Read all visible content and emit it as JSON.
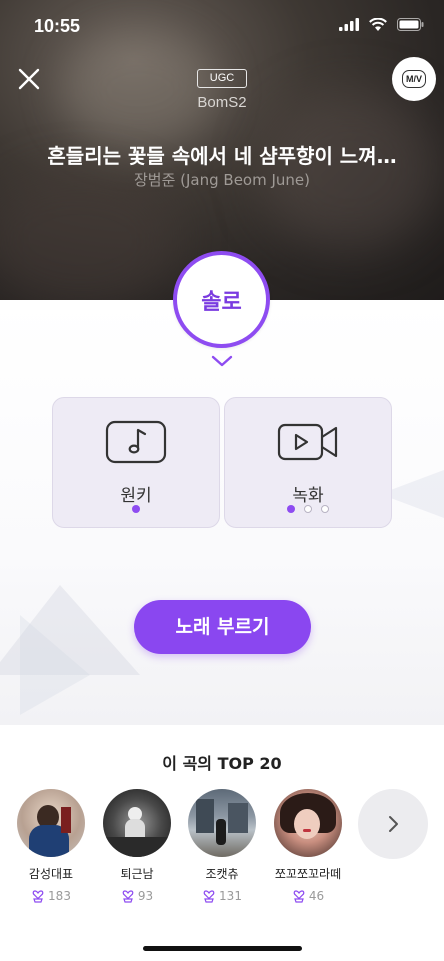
{
  "status": {
    "time": "10:55"
  },
  "hero": {
    "badge": "UGC",
    "uploader": "BomS2",
    "song_title": "흔들리는 꽃들 속에서 네 샴푸향이 느껴…",
    "artist": "장범준 (Jang Beom June)",
    "mv_label": "M/V"
  },
  "mode": {
    "selected": "솔로"
  },
  "options": [
    {
      "label": "원키",
      "dots": 1,
      "active": 0
    },
    {
      "label": "녹화",
      "dots": 3,
      "active": 0
    }
  ],
  "sing_button": "노래 부르기",
  "top20": {
    "title": "이 곡의 TOP 20",
    "users": [
      {
        "name": "감성대표",
        "count": "183"
      },
      {
        "name": "퇴근남",
        "count": "93"
      },
      {
        "name": "조캣츄",
        "count": "131"
      },
      {
        "name": "쪼꼬쪼꼬라떼",
        "count": "46"
      }
    ]
  },
  "colors": {
    "accent": "#8a47f0",
    "card_bg": "#eeebf5"
  }
}
